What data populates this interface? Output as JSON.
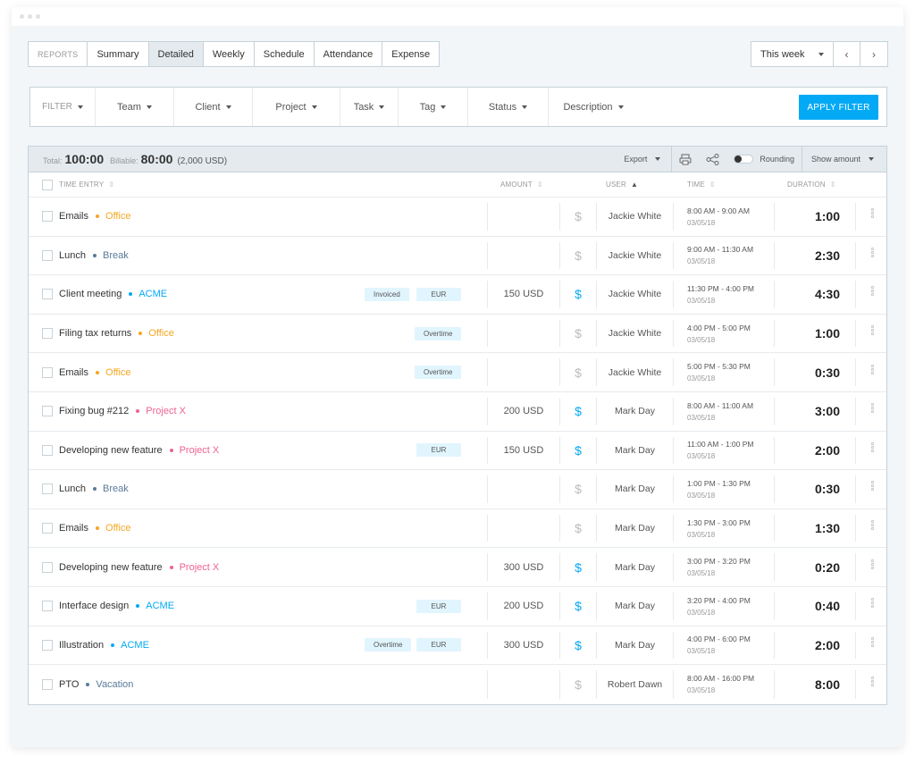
{
  "nav": {
    "reports_label": "REPORTS",
    "tabs": [
      {
        "label": "Summary",
        "active": false
      },
      {
        "label": "Detailed",
        "active": true
      },
      {
        "label": "Weekly",
        "active": false
      },
      {
        "label": "Schedule",
        "active": false
      },
      {
        "label": "Attendance",
        "active": false
      },
      {
        "label": "Expense",
        "active": false
      }
    ],
    "week_select": "This week",
    "prev_icon": "‹",
    "next_icon": "›"
  },
  "filter": {
    "label": "FILTER",
    "items": [
      "Team",
      "Client",
      "Project",
      "Task",
      "Tag",
      "Status",
      "Description"
    ],
    "apply_label": "APPLY FILTER"
  },
  "summary": {
    "total_label": "Total:",
    "total_value": "100:00",
    "billable_label": "Billable:",
    "billable_value": "80:00",
    "billable_amount": "(2,000 USD)",
    "export_label": "Export",
    "rounding_label": "Rounding",
    "show_amount_label": "Show amount"
  },
  "columns": {
    "entry": "TIME ENTRY",
    "amount": "AMOUNT",
    "user": "USER",
    "time": "TIME",
    "duration": "DURATION"
  },
  "colors": {
    "accent": "#03a9f4",
    "office": "#f5a623",
    "break": "#5a7a99",
    "acme": "#03a9f4",
    "projectx": "#f06292",
    "vacation": "#5a7a99"
  },
  "rows": [
    {
      "desc": "Emails",
      "project": "Office",
      "color": "#f5a623",
      "tags": [],
      "amount": "",
      "billable": false,
      "user": "Jackie White",
      "time": "8:00 AM - 9:00 AM",
      "date": "03/05/18",
      "duration": "1:00"
    },
    {
      "desc": "Lunch",
      "project": "Break",
      "color": "#5a7a99",
      "tags": [],
      "amount": "",
      "billable": false,
      "user": "Jackie White",
      "time": "9:00 AM - 11:30 AM",
      "date": "03/05/18",
      "duration": "2:30"
    },
    {
      "desc": "Client meeting",
      "project": "ACME",
      "color": "#03a9f4",
      "tags": [
        "Invoiced",
        "EUR"
      ],
      "amount": "150 USD",
      "billable": true,
      "user": "Jackie White",
      "time": "11:30 PM - 4:00 PM",
      "date": "03/05/18",
      "duration": "4:30"
    },
    {
      "desc": "Filing tax returns",
      "project": "Office",
      "color": "#f5a623",
      "tags": [
        "Overtime"
      ],
      "amount": "",
      "billable": false,
      "user": "Jackie White",
      "time": "4:00 PM - 5:00 PM",
      "date": "03/05/18",
      "duration": "1:00"
    },
    {
      "desc": "Emails",
      "project": "Office",
      "color": "#f5a623",
      "tags": [
        "Overtime"
      ],
      "amount": "",
      "billable": false,
      "user": "Jackie White",
      "time": "5:00 PM - 5:30 PM",
      "date": "03/05/18",
      "duration": "0:30"
    },
    {
      "desc": "Fixing bug #212",
      "project": "Project X",
      "color": "#f06292",
      "tags": [],
      "amount": "200 USD",
      "billable": true,
      "user": "Mark Day",
      "time": "8:00 AM - 11:00 AM",
      "date": "03/05/18",
      "duration": "3:00"
    },
    {
      "desc": "Developing new feature",
      "project": "Project X",
      "color": "#f06292",
      "tags": [
        "EUR"
      ],
      "amount": "150 USD",
      "billable": true,
      "user": "Mark Day",
      "time": "11:00 AM - 1:00 PM",
      "date": "03/05/18",
      "duration": "2:00"
    },
    {
      "desc": "Lunch",
      "project": "Break",
      "color": "#5a7a99",
      "tags": [],
      "amount": "",
      "billable": false,
      "user": "Mark Day",
      "time": "1:00 PM - 1:30 PM",
      "date": "03/05/18",
      "duration": "0:30"
    },
    {
      "desc": "Emails",
      "project": "Office",
      "color": "#f5a623",
      "tags": [],
      "amount": "",
      "billable": false,
      "user": "Mark Day",
      "time": "1:30 PM - 3:00 PM",
      "date": "03/05/18",
      "duration": "1:30"
    },
    {
      "desc": "Developing new feature",
      "project": "Project X",
      "color": "#f06292",
      "tags": [],
      "amount": "300 USD",
      "billable": true,
      "user": "Mark Day",
      "time": "3:00 PM - 3:20 PM",
      "date": "03/05/18",
      "duration": "0:20"
    },
    {
      "desc": "Interface design",
      "project": "ACME",
      "color": "#03a9f4",
      "tags": [
        "EUR"
      ],
      "amount": "200 USD",
      "billable": true,
      "user": "Mark Day",
      "time": "3:20 PM - 4:00 PM",
      "date": "03/05/18",
      "duration": "0:40"
    },
    {
      "desc": "Illustration",
      "project": "ACME",
      "color": "#03a9f4",
      "tags": [
        "Overtime",
        "EUR"
      ],
      "amount": "300 USD",
      "billable": true,
      "user": "Mark Day",
      "time": "4:00 PM - 6:00 PM",
      "date": "03/05/18",
      "duration": "2:00"
    },
    {
      "desc": "PTO",
      "project": "Vacation",
      "color": "#5a7a99",
      "tags": [],
      "amount": "",
      "billable": false,
      "user": "Robert Dawn",
      "time": "8:00 AM - 16:00 PM",
      "date": "03/05/18",
      "duration": "8:00"
    }
  ]
}
